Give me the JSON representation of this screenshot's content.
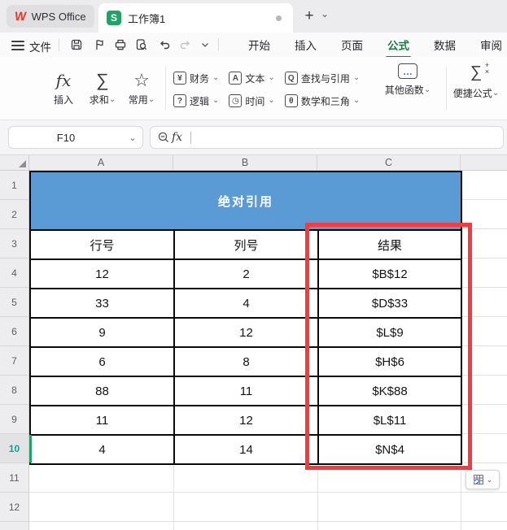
{
  "titlebar": {
    "app_name": "WPS Office",
    "document_name": "工作簿1",
    "document_badge": "S",
    "new_tab": "+"
  },
  "menubar": {
    "file": "文件",
    "tabs": [
      {
        "label": "开始",
        "active": false
      },
      {
        "label": "插入",
        "active": false
      },
      {
        "label": "页面",
        "active": false
      },
      {
        "label": "公式",
        "active": true
      },
      {
        "label": "数据",
        "active": false
      },
      {
        "label": "审阅",
        "active": false
      }
    ]
  },
  "ribbon": {
    "insert_fn": {
      "icon": "fx",
      "label": "插入"
    },
    "sum": {
      "icon": "∑",
      "label": "求和"
    },
    "common": {
      "icon": "☆",
      "label": "常用"
    },
    "small": [
      {
        "glyph": "¥",
        "label": "财务"
      },
      {
        "glyph": "A",
        "label": "文本"
      },
      {
        "glyph": "Q",
        "label": "查找与引用"
      },
      {
        "glyph": "?",
        "label": "逻辑"
      },
      {
        "glyph": "◷",
        "label": "时间"
      },
      {
        "glyph": "θ",
        "label": "数学和三角"
      }
    ],
    "other_fn": {
      "glyph": "…",
      "label": "其他函数"
    },
    "quick": {
      "icon": "∑",
      "label": "便捷公式"
    }
  },
  "formula_bar": {
    "name_box_value": "F10",
    "fx_label": "fx"
  },
  "grid": {
    "col_headers": [
      "A",
      "B",
      "C"
    ],
    "row_headers": [
      "1",
      "2",
      "3",
      "4",
      "5",
      "6",
      "7",
      "8",
      "9",
      "10",
      "11",
      "12"
    ],
    "selected_row": "10"
  },
  "sheet": {
    "title": "绝对引用",
    "headers": [
      "行号",
      "列号",
      "结果"
    ],
    "rows": [
      [
        "12",
        "2",
        "$B$12"
      ],
      [
        "33",
        "4",
        "$D$33"
      ],
      [
        "9",
        "12",
        "$L$9"
      ],
      [
        "6",
        "8",
        "$H$6"
      ],
      [
        "88",
        "11",
        "$K$88"
      ],
      [
        "11",
        "12",
        "$L$11"
      ],
      [
        "4",
        "14",
        "$N$4"
      ]
    ]
  },
  "colors": {
    "accent_green": "#1B7A48",
    "header_blue": "#5B9BD5",
    "highlight_red": "#FA3A3A",
    "selected_indicator_green": "#21A366",
    "selected_row_number_teal": "#1F9C8C"
  }
}
